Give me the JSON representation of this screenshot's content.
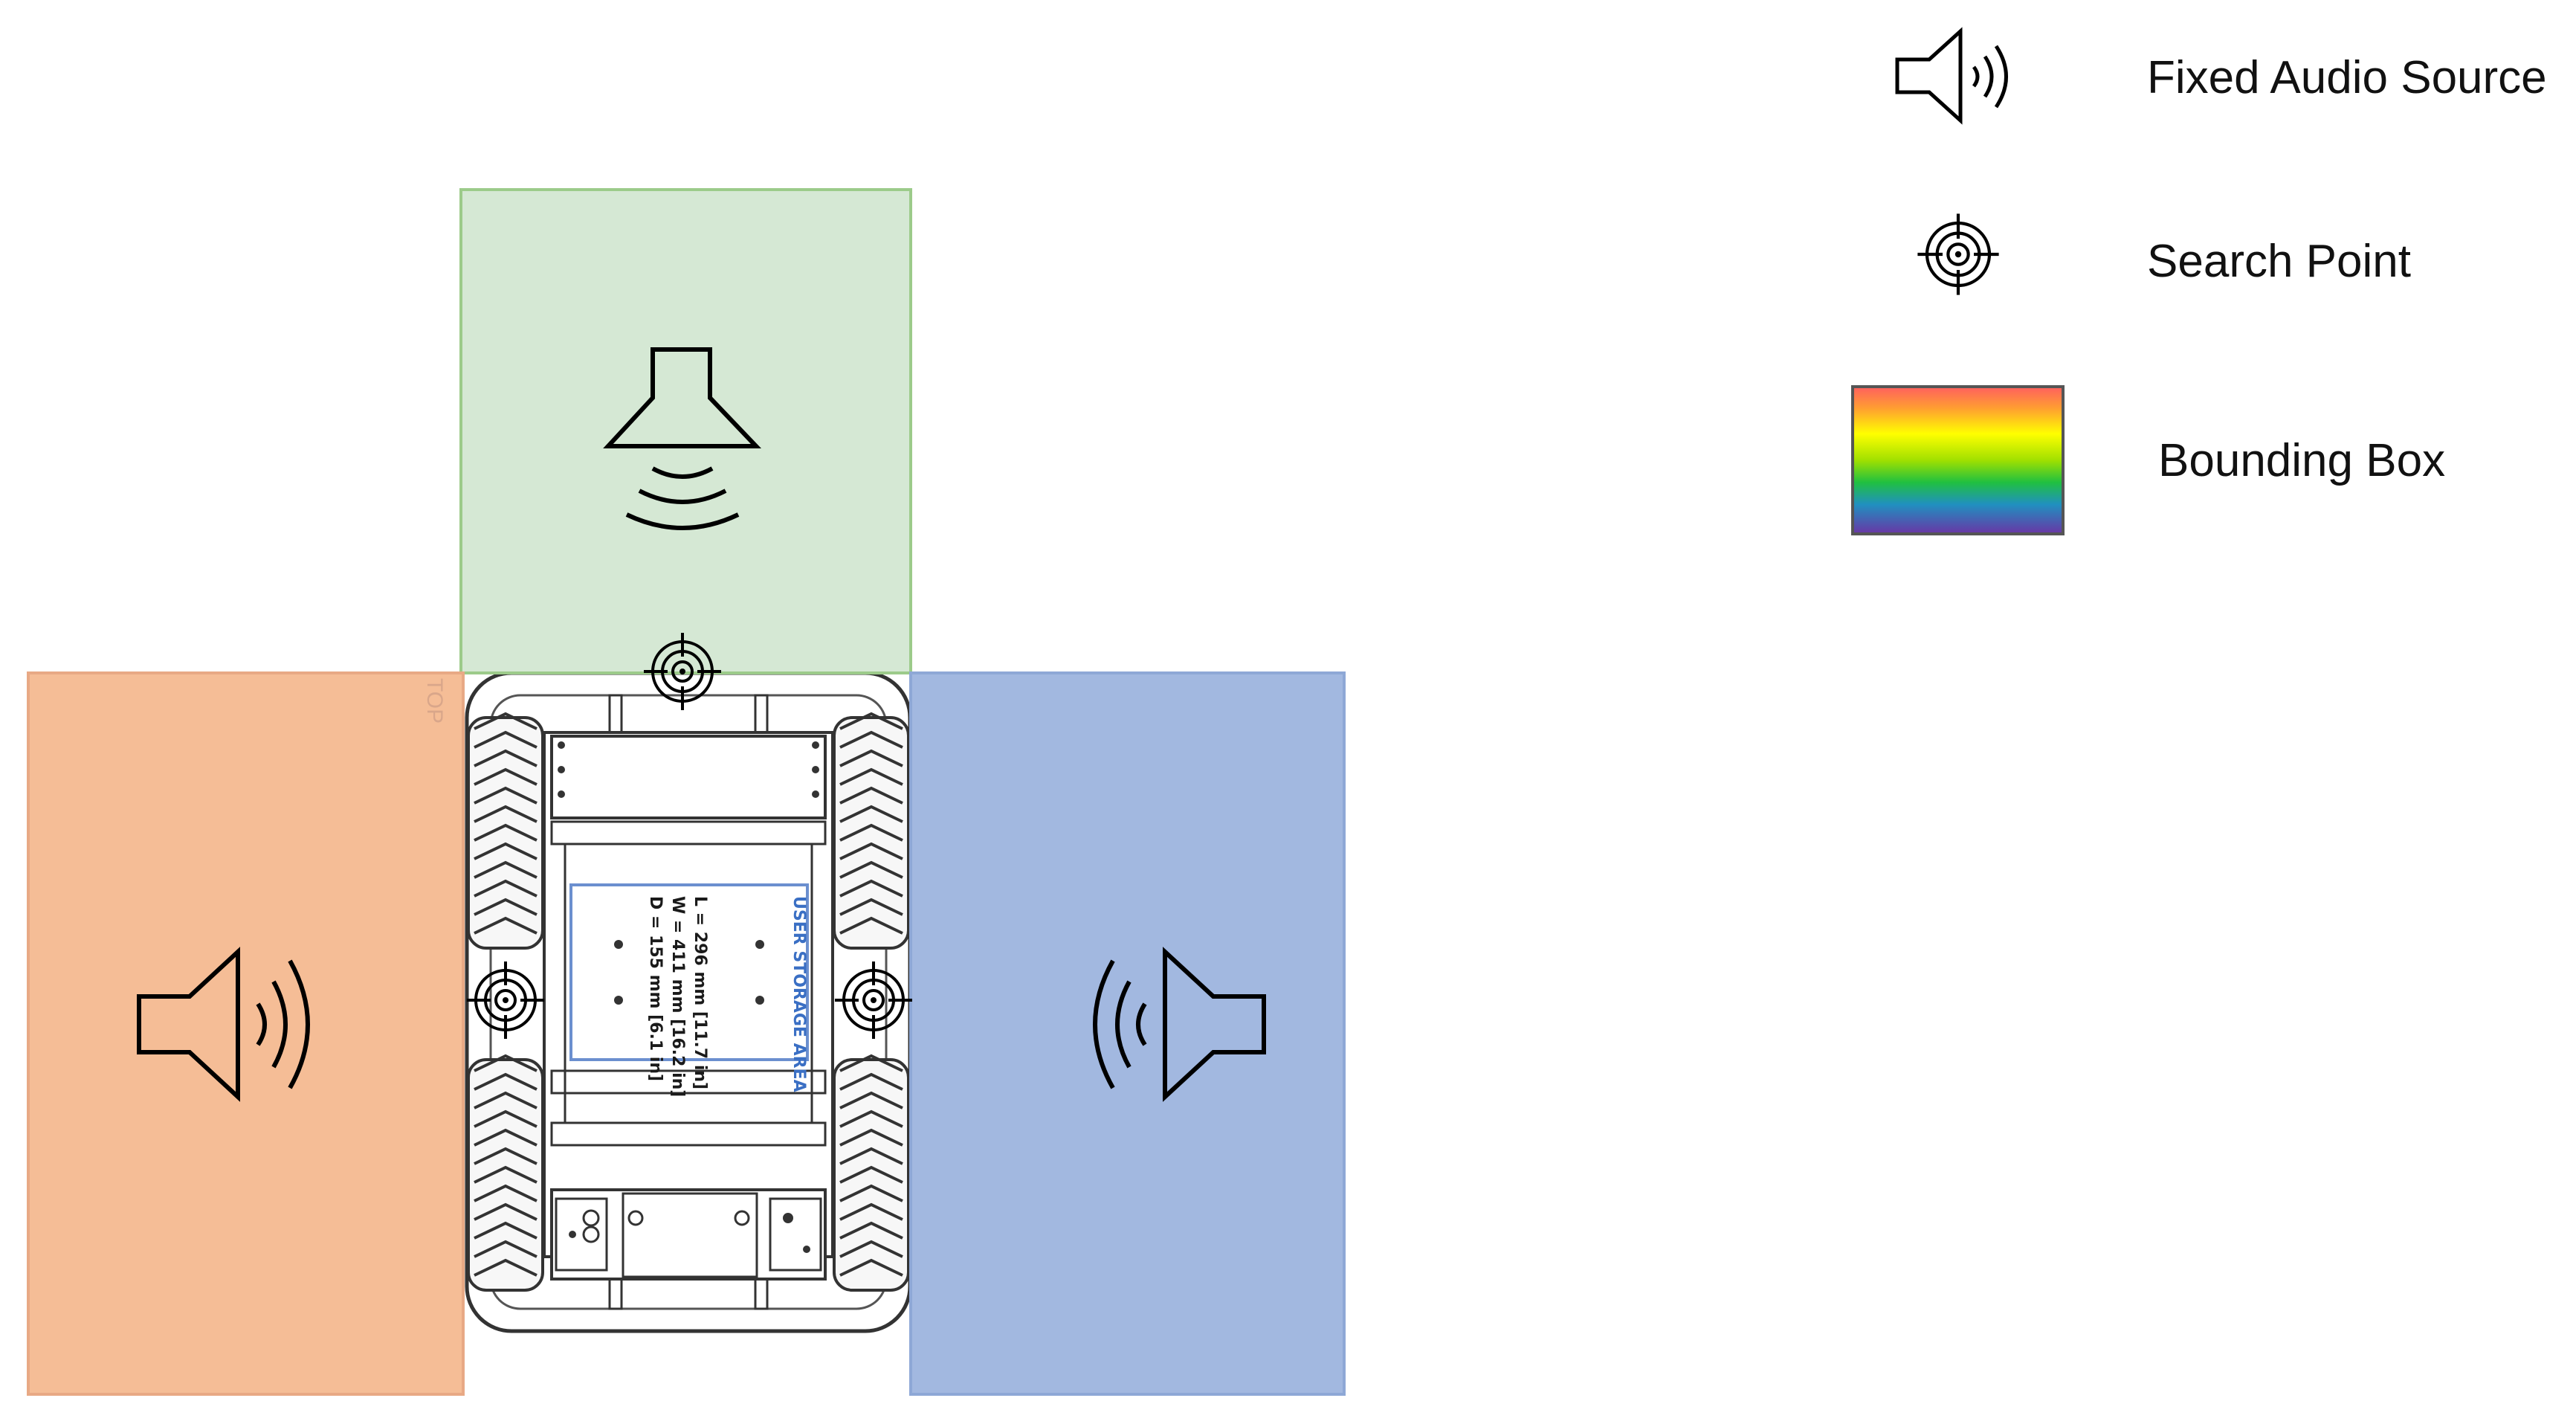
{
  "legend": {
    "audio_source_label": "Fixed Audio Source",
    "search_point_label": "Search Point",
    "bounding_box_label": "Bounding Box",
    "audio_source_icon": "speaker-icon",
    "search_point_icon": "crosshair-icon"
  },
  "zones": {
    "front_color": "#d5e8d4",
    "left_color": "#f5bd96",
    "right_color": "#a2b8e0"
  },
  "robot": {
    "top_label": "TOP",
    "storage_title": "USER STORAGE AREA",
    "dim_length": "L = 296 mm [11.7 in]",
    "dim_width": "W = 411 mm [16.2 in]",
    "dim_depth": "D = 155 mm [6.1 in]"
  }
}
